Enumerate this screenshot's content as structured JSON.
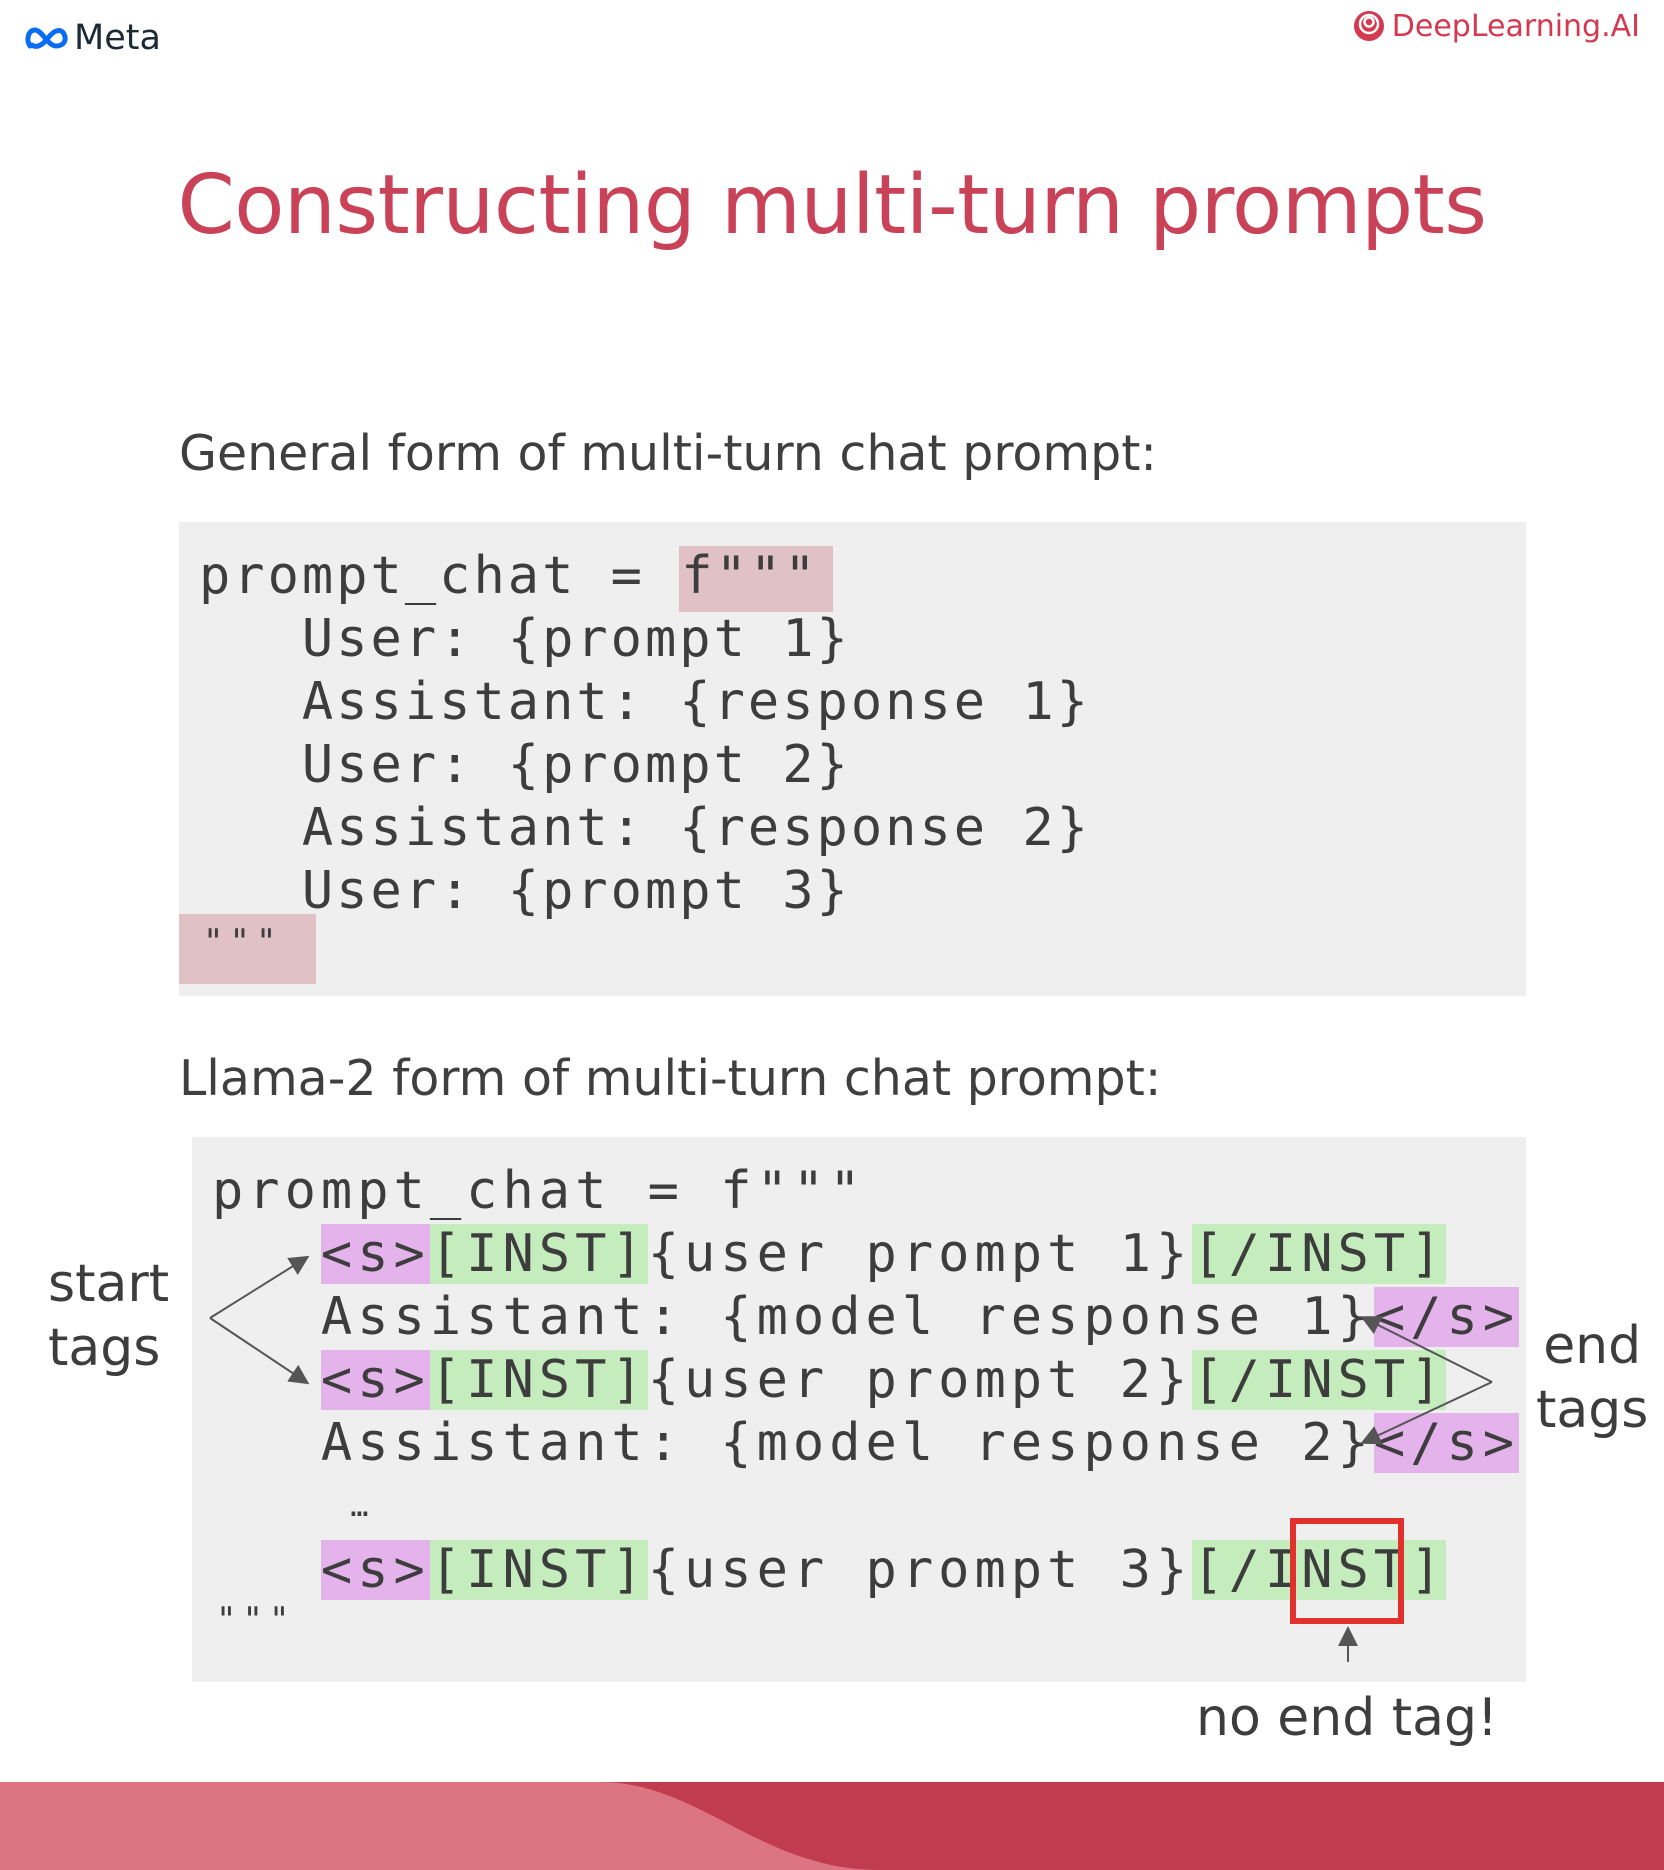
{
  "header": {
    "meta_logo_text": "Meta",
    "dl_logo_text": "DeepLearning.AI"
  },
  "title": "Constructing multi-turn prompts",
  "general": {
    "label": "General form of multi-turn chat prompt:",
    "code_lines": [
      {
        "text": "prompt_chat = ",
        "hl": "f\"\"\""
      },
      {
        "text": "   User: {prompt 1}"
      },
      {
        "text": "   Assistant: {response 1}"
      },
      {
        "text": "   User: {prompt 2}"
      },
      {
        "text": "   Assistant: {response 2}"
      },
      {
        "text": "   User: {prompt 3}"
      }
    ],
    "closing_quotes": "\"\"\""
  },
  "llama": {
    "label": "Llama-2 form of multi-turn chat prompt:",
    "first_line": "prompt_chat = f\"\"\"",
    "tok_s": "<s>",
    "tok_inst": "[INST]",
    "tok_inst_end": "[/INST]",
    "tok_s_end": "</s>",
    "user_prompt_1": "{user prompt 1}",
    "model_response_1": "Assistant: {model response 1}",
    "user_prompt_2": "{user prompt 2}",
    "model_response_2": "Assistant: {model response 2}",
    "ellipsis": "…",
    "user_prompt_3": "{user prompt 3}",
    "closing_quotes": "\"\"\""
  },
  "annotations": {
    "start_tags": "start\ntags",
    "end_tags": "end\ntags",
    "no_end_tag": "no end tag!"
  },
  "colors": {
    "title": "#c94257",
    "highlight_red": "#e0c2c6",
    "highlight_pink": "#e4b3ec",
    "highlight_green": "#c4ecbc",
    "missing_tag_box": "#e0312c",
    "band_light": "#dc7581",
    "band_dark": "#c13c4f"
  }
}
